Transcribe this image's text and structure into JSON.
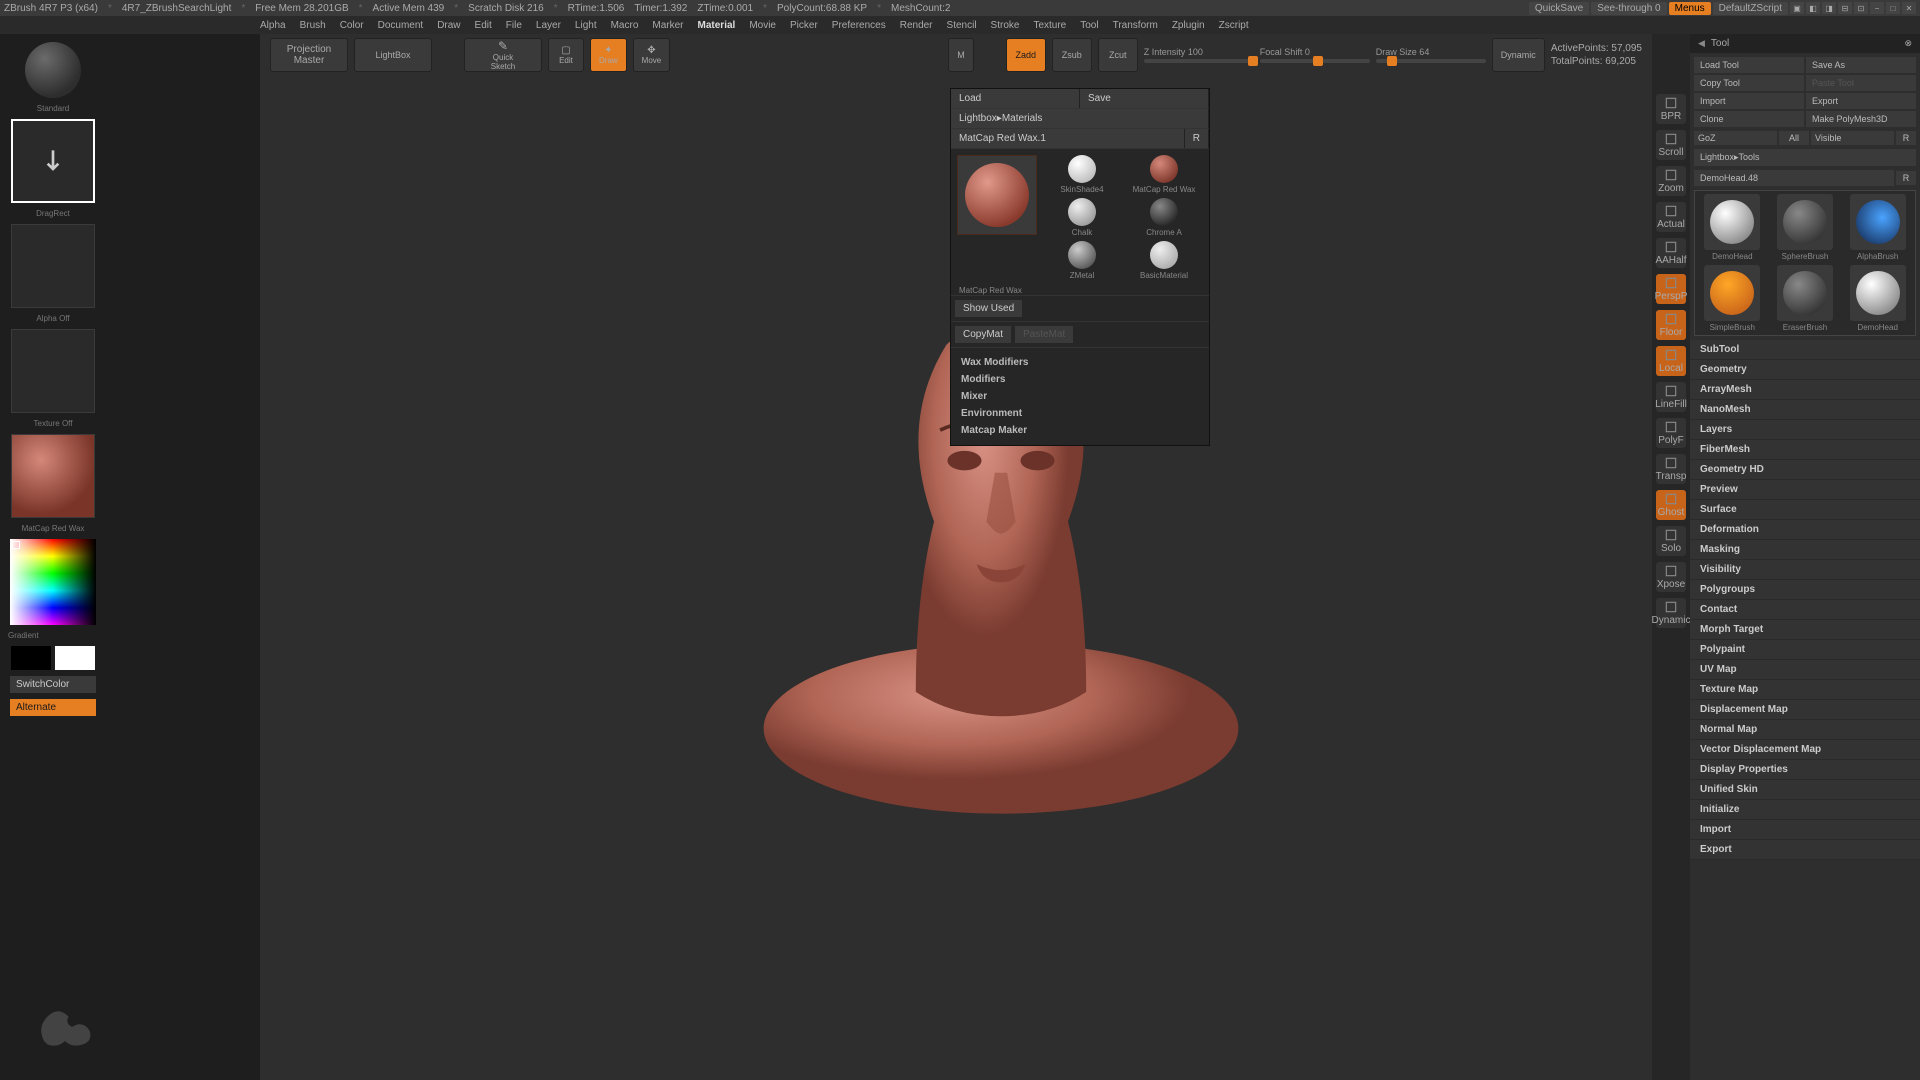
{
  "titlebar": {
    "app": "ZBrush 4R7 P3 (x64)",
    "project": "4R7_ZBrushSearchLight",
    "freemem": "Free Mem 28.201GB",
    "activemem": "Active Mem 439",
    "scratch": "Scratch Disk 216",
    "rtime": "RTime:1.506",
    "timer": "Timer:1.392",
    "zt": "ZTime:0.001",
    "poly": "PolyCount:68.88 KP",
    "mesh": "MeshCount:2",
    "quicksave": "QuickSave",
    "seethrough": "See-through  0",
    "menus": "Menus",
    "script": "DefaultZScript"
  },
  "menubar": [
    "Alpha",
    "Brush",
    "Color",
    "Document",
    "Draw",
    "Edit",
    "File",
    "Layer",
    "Light",
    "Macro",
    "Marker",
    "Material",
    "Movie",
    "Picker",
    "Preferences",
    "Render",
    "Stencil",
    "Stroke",
    "Texture",
    "Tool",
    "Transform",
    "Zplugin",
    "Zscript"
  ],
  "menubar_active": "Material",
  "toolbar": {
    "projection": "Projection\nMaster",
    "lightbox": "LightBox",
    "quicksketch": "Quick\nSketch",
    "edit": "Edit",
    "draw": "Draw",
    "move": "Move",
    "mrgb_m": "M",
    "zadd": "Zadd",
    "zsub": "Zsub",
    "zcut": "Zcut",
    "zintensity": "Z Intensity 100",
    "focal": "Focal Shift 0",
    "drawsize": "Draw Size 64",
    "dynamic": "Dynamic",
    "activepoints_lbl": "ActivePoints:",
    "activepoints_val": "57,095",
    "totalpoints_lbl": "TotalPoints:",
    "totalpoints_val": "69,205"
  },
  "material_popup": {
    "load": "Load",
    "save": "Save",
    "lightbox_mats": "Lightbox▸Materials",
    "current": "MatCap Red Wax.1",
    "r": "R",
    "swatches": [
      "MatCap Red Wax",
      "SkinShade4",
      "MatCap Red Wax",
      "Chalk",
      "Chrome A",
      "ZMetal",
      "BasicMaterial"
    ],
    "show_used": "Show Used",
    "copymat": "CopyMat",
    "pastemat": "PasteMat",
    "submenus": [
      "Wax Modifiers",
      "Modifiers",
      "Mixer",
      "Environment",
      "Matcap Maker"
    ]
  },
  "left": {
    "dragrect": "DragRect",
    "alpha_off": "Alpha Off",
    "texture_off": "Texture Off",
    "matcap": "MatCap Red Wax",
    "gradient": "Gradient",
    "switchcolor": "SwitchColor",
    "alternate": "Alternate"
  },
  "rightstrip": [
    "BPR",
    "Scroll",
    "Zoom",
    "Actual",
    "AAHalf",
    "PerspP",
    "Floor",
    "Local",
    "LineFill",
    "PolyF",
    "Transp",
    "Ghost",
    "Solo",
    "Xpose",
    "Dynamic"
  ],
  "tool": {
    "header": "Tool",
    "buttons": {
      "load_tool": "Load Tool",
      "save_as": "Save As",
      "copy_tool": "Copy Tool",
      "paste_tool": "Paste Tool",
      "import": "Import",
      "export": "Export",
      "clone": "Clone",
      "make_polymesh": "Make PolyMesh3D",
      "goz": "GoZ",
      "all": "All",
      "visible": "Visible",
      "r": "R"
    },
    "lightbox_tools": "Lightbox▸Tools",
    "current_tool": "DemoHead.48",
    "brushes": [
      "DemoHead",
      "SphereBrush",
      "AlphaBrush",
      "SimpleBrush",
      "EraserBrush",
      "DemoHead"
    ],
    "sections": [
      "SubTool",
      "Geometry",
      "ArrayMesh",
      "NanoMesh",
      "Layers",
      "FiberMesh",
      "Geometry HD",
      "Preview",
      "Surface",
      "Deformation",
      "Masking",
      "Visibility",
      "Polygroups",
      "Contact",
      "Morph Target",
      "Polypaint",
      "UV Map",
      "Texture Map",
      "Displacement Map",
      "Normal Map",
      "Vector Displacement Map",
      "Display Properties",
      "Unified Skin",
      "Initialize",
      "Import",
      "Export"
    ]
  }
}
